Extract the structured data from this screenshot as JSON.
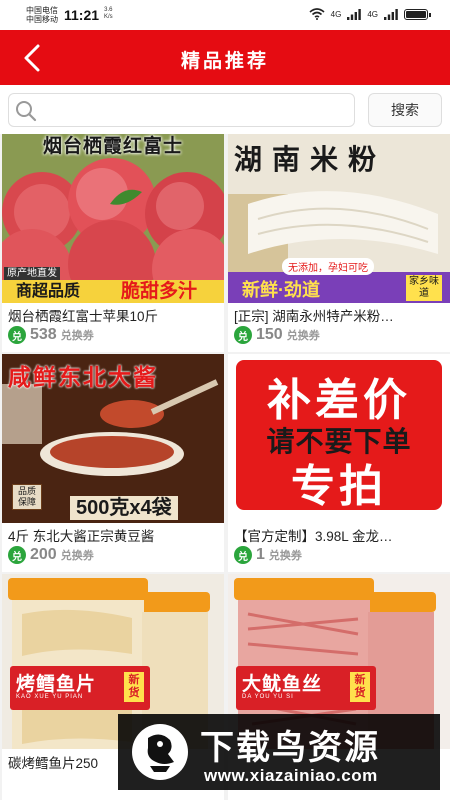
{
  "status_bar": {
    "carrier_1": "中国电信",
    "carrier_2": "中国移动",
    "time": "11:21",
    "net_speed_value": "3.6",
    "net_speed_unit": "K/s",
    "signal_1": "4G",
    "signal_2": "4G"
  },
  "header": {
    "title": "精品推荐",
    "back_icon": "chevron-left-icon"
  },
  "search": {
    "placeholder": "",
    "value": "",
    "button_label": "搜索"
  },
  "products": [
    {
      "image_text_top": "烟台栖霞红富士",
      "image_tag": "原产地直发",
      "image_text_left": "商超品质",
      "image_text_right": "脆甜多汁",
      "title": "烟台栖霞红富士苹果10斤",
      "points": "538",
      "badge": "兑",
      "unit": "兑换券"
    },
    {
      "image_text_top": "湖南米粉",
      "image_sticker": "无添加，孕妇可吃",
      "image_text_bottom": "新鲜·劲道",
      "image_text_side": "家乡味道",
      "title": "[正宗] 湖南永州特产米粉…",
      "points": "150",
      "badge": "兑",
      "unit": "兑换券"
    },
    {
      "image_text_top": "咸鲜东北大酱",
      "image_stamp": "品质保障",
      "image_text_bottom": "500克x4袋",
      "title": "4斤 东北大酱正宗黄豆酱",
      "points": "200",
      "badge": "兑",
      "unit": "兑换券"
    },
    {
      "image_text_line1": "补差价",
      "image_text_overlay": "请不要下单",
      "image_text_line2": "专拍",
      "title": "【官方定制】3.98L 金龙…",
      "points": "1",
      "badge": "兑",
      "unit": "兑换券"
    },
    {
      "image_label": "烤鳕鱼片",
      "image_pinyin": "KAO XUE YU PIAN",
      "image_new_tag": "新货",
      "title": "碳烤鳕鱼片250"
    },
    {
      "image_label": "大鱿鱼丝",
      "image_pinyin": "DA YOU YU SI",
      "image_new_tag": "新货",
      "title": ""
    }
  ],
  "watermark": {
    "title": "下载鸟资源",
    "url": "www.xiazainiao.com"
  },
  "colors": {
    "brand_red": "#e50c12",
    "coupon_green": "#2ba53c",
    "points_gray": "#888888"
  }
}
